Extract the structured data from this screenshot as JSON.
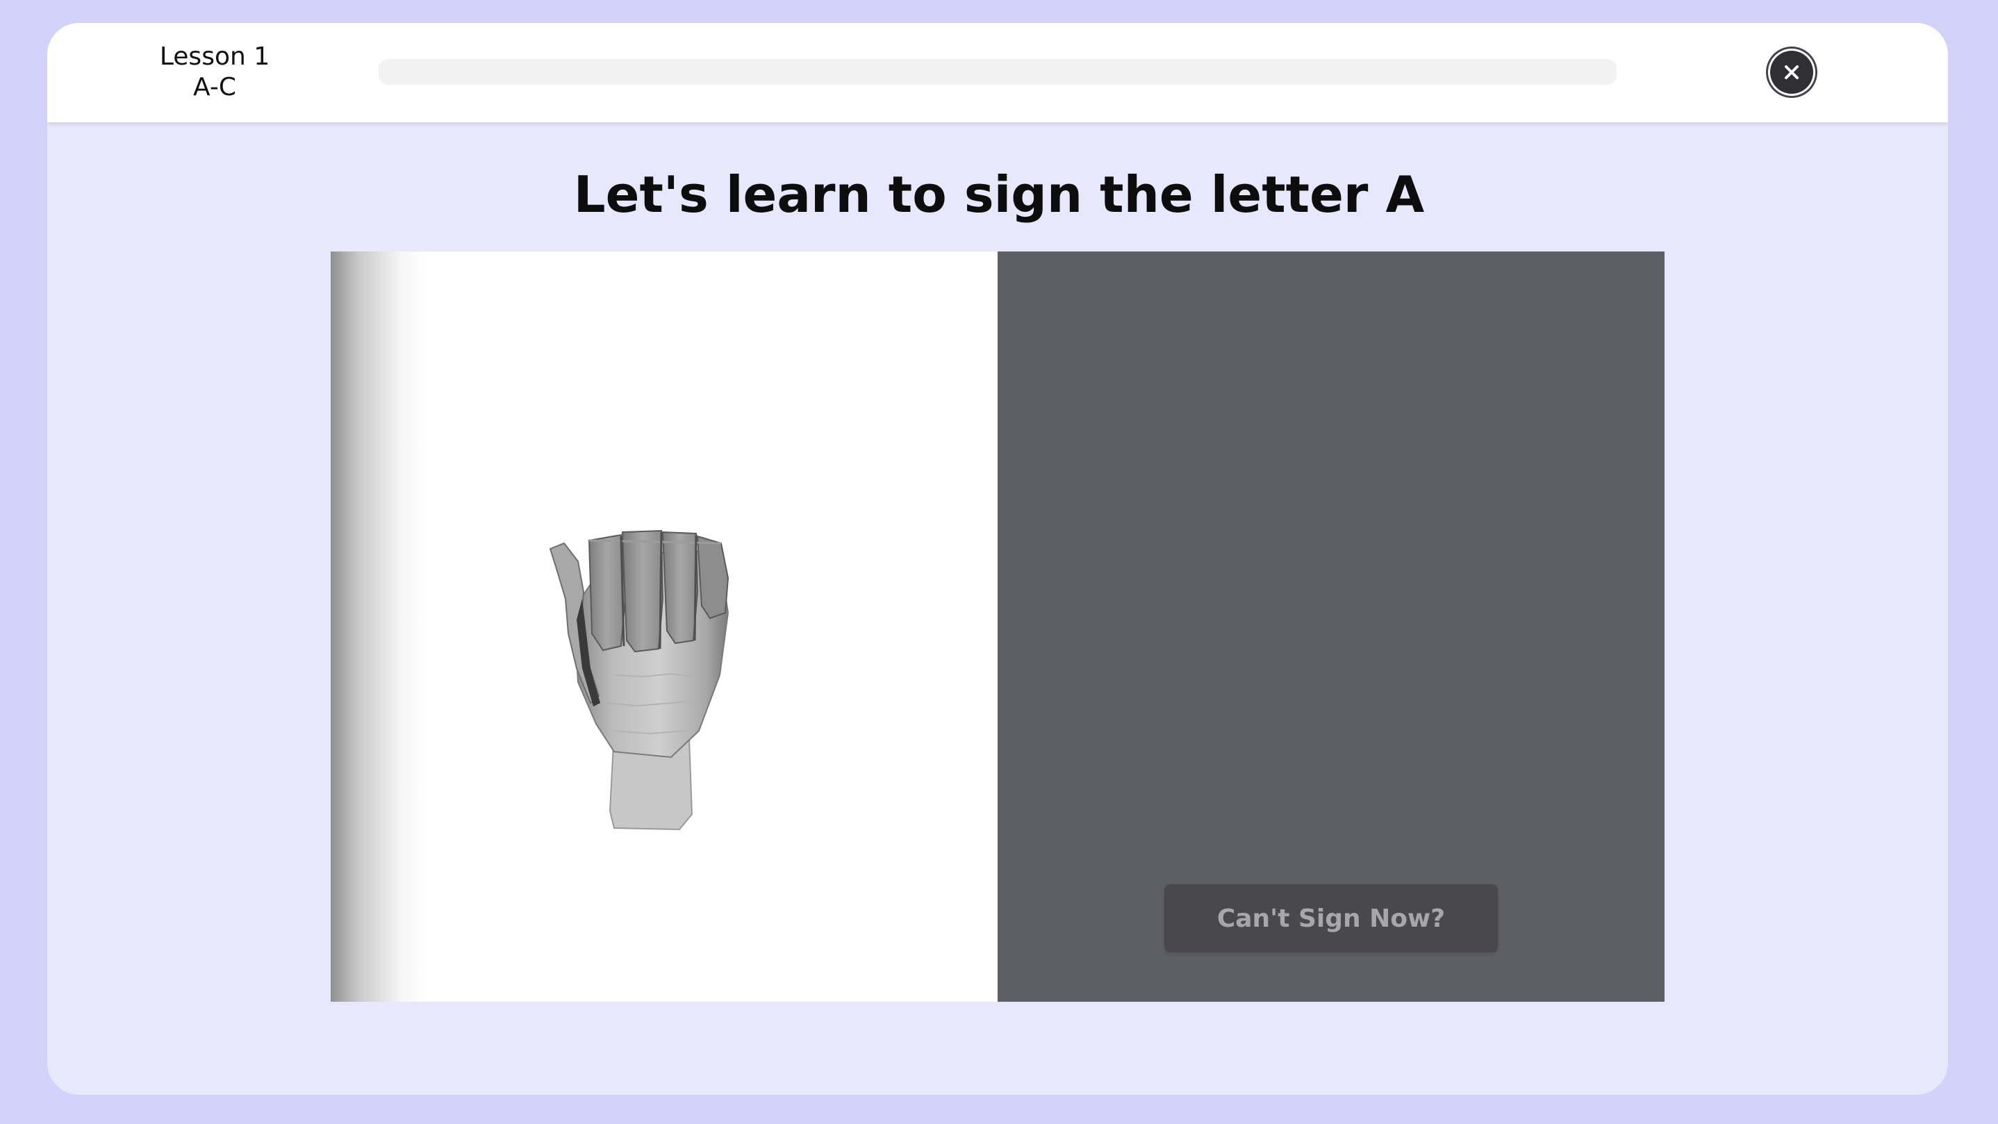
{
  "lesson": {
    "name": "Lesson 1",
    "range": "A-C"
  },
  "progress": {
    "value_percent": 0
  },
  "close_button": {
    "icon": "close-icon"
  },
  "main": {
    "title": "Let's learn to sign the letter A"
  },
  "demo": {
    "model": "hand-sign-letter-a"
  },
  "camera": {
    "cant_sign_label": "Can't Sign Now?"
  },
  "colors": {
    "background": "#d3d3f9",
    "card": "#e8e8fc",
    "camera_panel": "#5e5f64",
    "button": "#48484d"
  }
}
